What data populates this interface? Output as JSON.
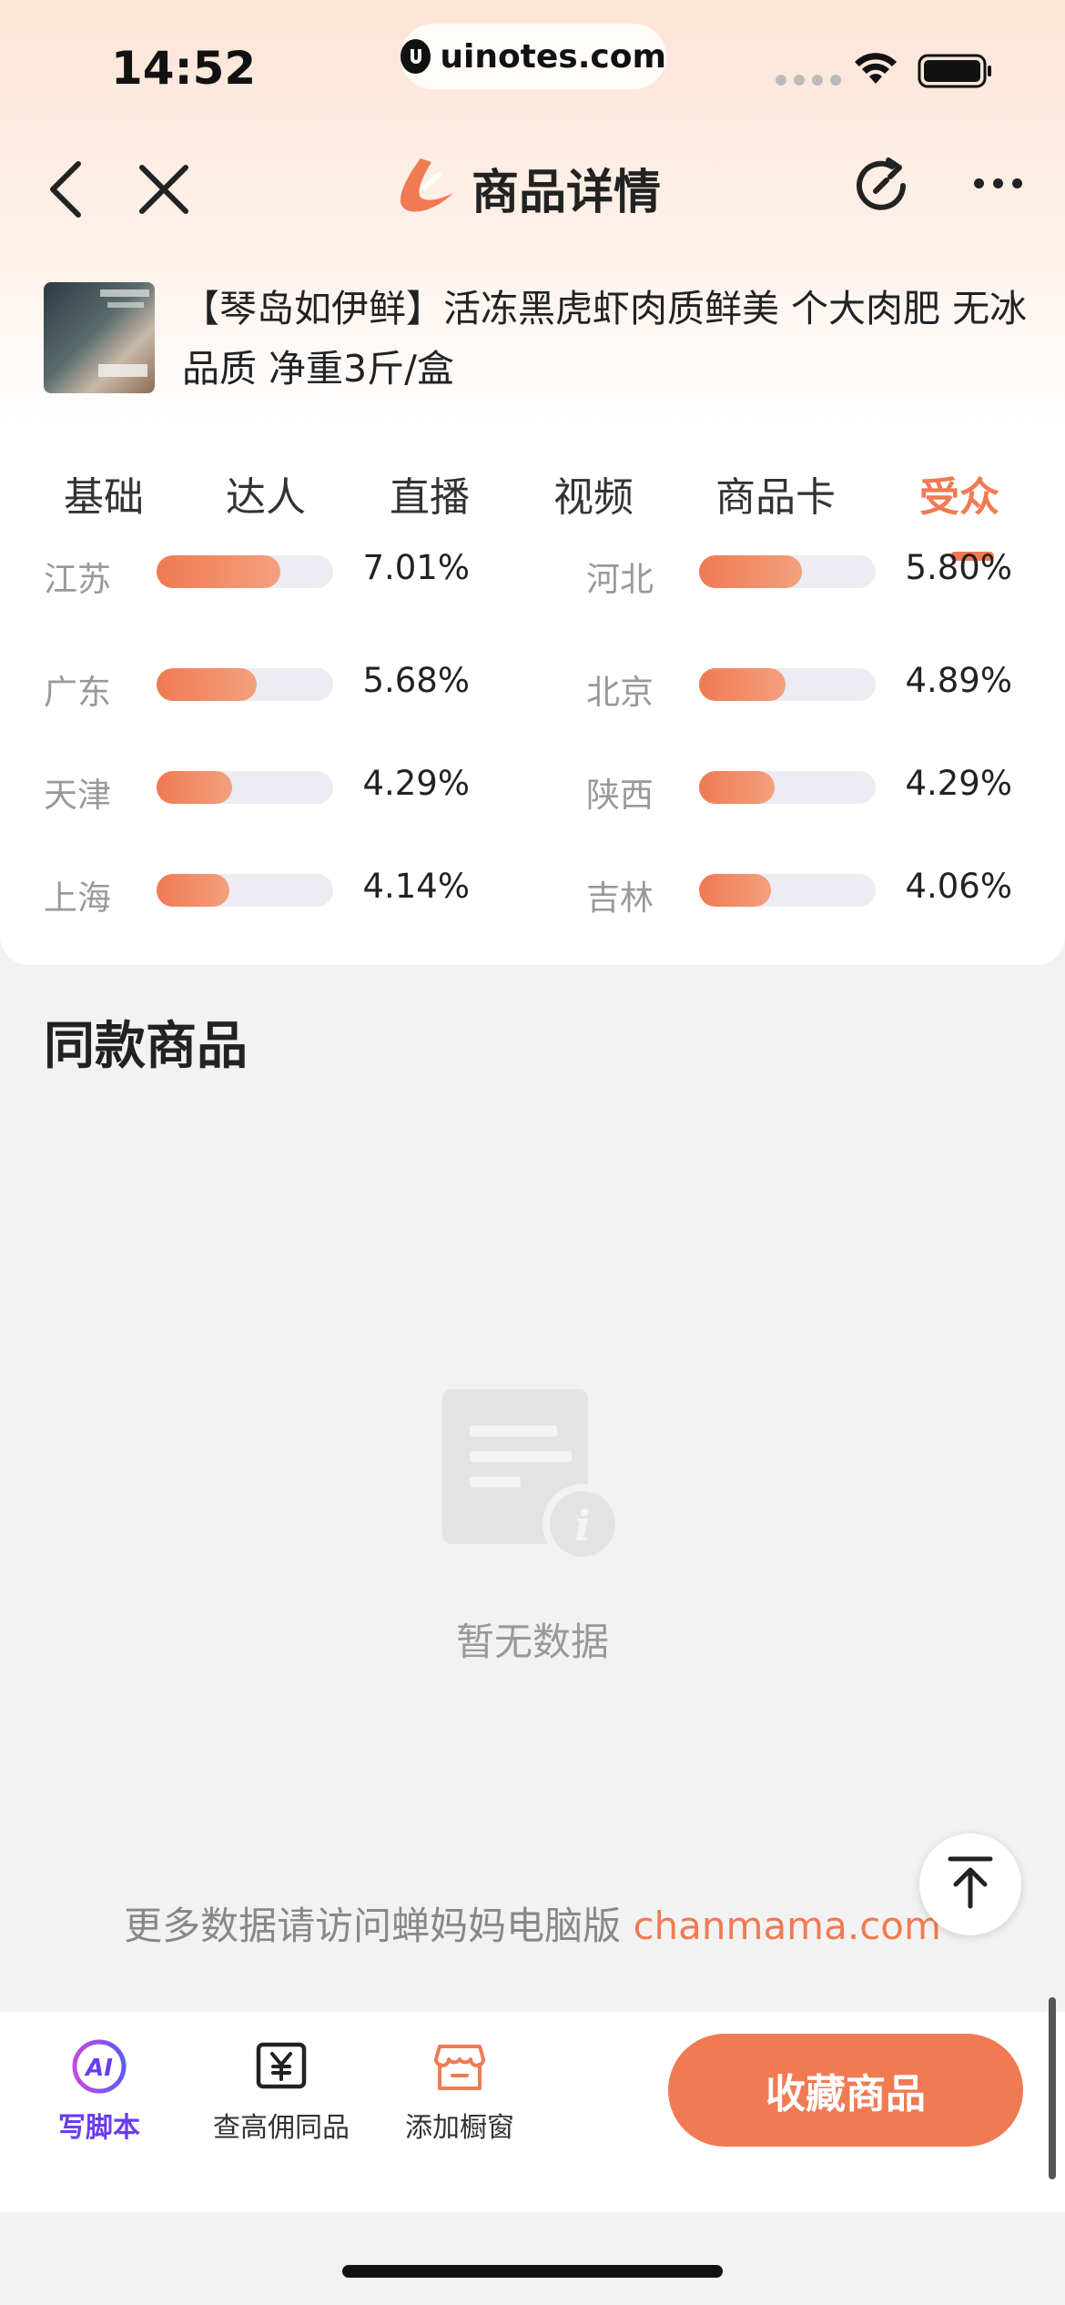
{
  "status_bar": {
    "time": "14:52",
    "url": "uinotes.com"
  },
  "nav": {
    "title": "商品详情"
  },
  "product": {
    "title": "【琴岛如伊鲜】活冻黑虎虾肉质鲜美 个大肉肥 无冰品质 净重3斤/盒"
  },
  "tabs": [
    {
      "label": "基础",
      "active": false
    },
    {
      "label": "达人",
      "active": false
    },
    {
      "label": "直播",
      "active": false
    },
    {
      "label": "视频",
      "active": false
    },
    {
      "label": "商品卡",
      "active": false
    },
    {
      "label": "受众",
      "active": true
    }
  ],
  "regions": [
    {
      "name": "江苏",
      "percent": "7.01%",
      "value": 7.01
    },
    {
      "name": "河北",
      "percent": "5.80%",
      "value": 5.8
    },
    {
      "name": "广东",
      "percent": "5.68%",
      "value": 5.68
    },
    {
      "name": "北京",
      "percent": "4.89%",
      "value": 4.89
    },
    {
      "name": "天津",
      "percent": "4.29%",
      "value": 4.29
    },
    {
      "name": "陕西",
      "percent": "4.29%",
      "value": 4.29
    },
    {
      "name": "上海",
      "percent": "4.14%",
      "value": 4.14
    },
    {
      "name": "吉林",
      "percent": "4.06%",
      "value": 4.06
    }
  ],
  "same_products": {
    "title": "同款商品",
    "empty_text": "暂无数据"
  },
  "footer": {
    "note": "更多数据请访问蝉妈妈电脑版",
    "link": "chanmama.com"
  },
  "bottom_actions": [
    {
      "label": "写脚本",
      "icon": "ai-icon"
    },
    {
      "label": "查高佣同品",
      "icon": "yen-icon"
    },
    {
      "label": "添加橱窗",
      "icon": "shop-icon"
    }
  ],
  "collect_button": "收藏商品",
  "colors": {
    "accent": "#f07a52",
    "ai": "#6a3cf0"
  }
}
